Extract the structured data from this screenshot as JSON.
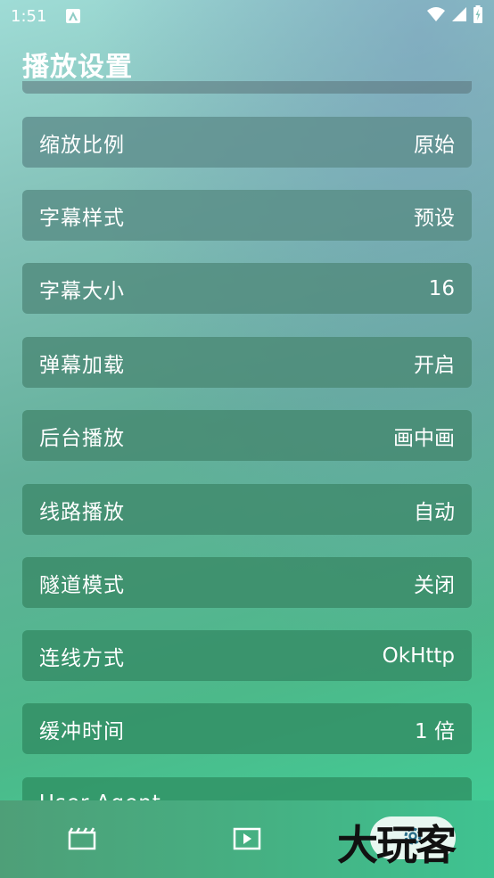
{
  "status_bar": {
    "time": "1:51",
    "notification_icon": "a-letter-icon",
    "icons": [
      "wifi-icon",
      "signal-icon",
      "battery-charging-icon"
    ]
  },
  "page": {
    "title": "播放设置"
  },
  "settings": [
    {
      "label": "缩放比例",
      "value": "原始"
    },
    {
      "label": "字幕样式",
      "value": "预设"
    },
    {
      "label": "字幕大小",
      "value": "16"
    },
    {
      "label": "弹幕加载",
      "value": "开启"
    },
    {
      "label": "后台播放",
      "value": "画中画"
    },
    {
      "label": "线路播放",
      "value": "自动"
    },
    {
      "label": "隧道模式",
      "value": "关闭"
    },
    {
      "label": "连线方式",
      "value": "OkHttp"
    },
    {
      "label": "缓冲时间",
      "value": "1 倍"
    },
    {
      "label": "User-Agent",
      "value": ""
    }
  ],
  "bottom_nav": {
    "items": [
      "clapperboard-icon",
      "play-box-icon",
      "gear-icon"
    ],
    "selected": "gear-icon"
  },
  "watermark": {
    "text": "大玩客"
  },
  "colors": {
    "row_bg_top": "#5f8f8d",
    "row_bg_bottom": "#35936a",
    "text": "#ffffff",
    "nav_pill": "#ffffff"
  }
}
